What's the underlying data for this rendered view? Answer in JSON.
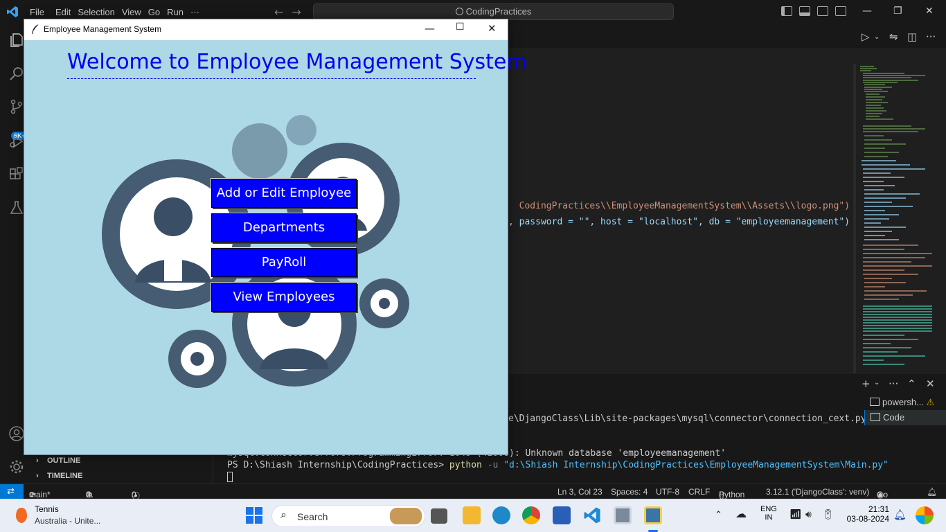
{
  "vscode": {
    "menu": [
      "File",
      "Edit",
      "Selection",
      "View",
      "Go",
      "Run",
      "···"
    ],
    "search": "CodingPractices",
    "badge": "6K+",
    "sidebar": {
      "outline": "OUTLINE",
      "timeline": "TIMELINE"
    },
    "code_lines": [
      "CodingPractices\\\\EmployeeManagementSystem\\\\Assets\\\\logo.png\")",
      ", password = \"\", host = \"localhost\", db = \"employeemanagement\")"
    ],
    "terminal": {
      "line1": "e\\DjangoClass\\Lib\\site-packages\\mysql\\connector\\connection_cext.py\", li",
      "line2_prefix": "mysql.connector.errors.ProgrammingError: 1049 (42000): ",
      "line2": "Unknown database 'employeemanagement'",
      "prompt": "PS D:\\Shiash Internship\\CodingPractices> ",
      "cmd": "python",
      "flag": " -u ",
      "path": "\"d:\\Shiash Internship\\CodingPractices\\EmployeeManagementSystem\\Main.py\"",
      "tabs": [
        "powersh...",
        "Code"
      ]
    },
    "status": {
      "branch": "main*",
      "errors": "0",
      "warnings": "0",
      "ports": "0",
      "position": "Ln 3, Col 23",
      "spaces": "Spaces: 4",
      "encoding": "UTF-8",
      "eol": "CRLF",
      "language": "Python",
      "interpreter": "3.12.1 ('DjangoClass': venv)",
      "golive": "Go Live"
    }
  },
  "taskbar": {
    "weather_title": "Tennis",
    "weather_sub": "Australia - Unite...",
    "search": "Search",
    "lang1": "ENG",
    "lang2": "IN",
    "time": "21:31",
    "date": "03-08-2024"
  },
  "app": {
    "window_title": "Employee Management System",
    "heading": "Welcome to Employee Management System",
    "buttons": {
      "add_edit": "Add or Edit Employee",
      "departments": "Departments",
      "payroll": "PayRoll",
      "view": "View Employees"
    },
    "colors": {
      "background": "#add8e6",
      "button": "#0000ff",
      "heading": "#0000ee"
    }
  }
}
